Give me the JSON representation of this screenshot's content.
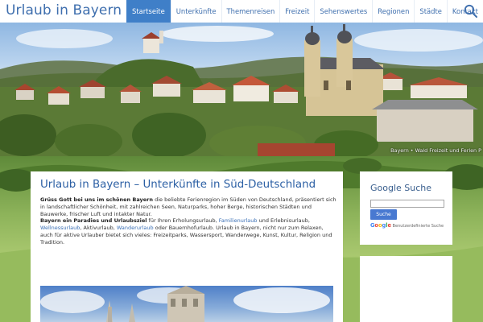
{
  "header": {
    "site_title": "Urlaub in Bayern",
    "nav": [
      {
        "label": "Startseite",
        "active": true
      },
      {
        "label": "Unterkünfte"
      },
      {
        "label": "Themenreisen"
      },
      {
        "label": "Freizeit"
      },
      {
        "label": "Sehenswertes"
      },
      {
        "label": "Regionen"
      },
      {
        "label": "Städte"
      },
      {
        "label": "Kontakt"
      }
    ],
    "search_icon": "search-icon"
  },
  "hero": {
    "caption": "Bayern • Wald Freizeit und Ferien P"
  },
  "main": {
    "title": "Urlaub in Bayern – Unterkünfte in Süd-Deutschland",
    "intro": {
      "p1_bold": "Grüss Gott bei uns im schönen Bayern",
      "p1_text": " die beliebte Ferienregion im Süden von Deutschland, präsentiert sich in landschaftlicher Schönheit, mit zahlreichen Seen, Naturparks, hoher Berge, historischen Städten und Bauwerke, frischer Luft und intakter Natur.",
      "p2_bold": "Bayern ein Paradies und Urlaubsziel",
      "p2_a": " für Ihren Erholungsurlaub, ",
      "link1": "Familienurlaub",
      "p2_b": " und Erlebnisurlaub, ",
      "link2": "Wellnessurlaub",
      "p2_c": ", Aktivurlaub, ",
      "link3": "Wanderurlaub",
      "p2_d": " oder Bauernhofurlaub. Urlaub in Bayern, nicht nur zum Relaxen, auch für aktive Urlauber bietet sich vieles: Freizeitparks, Wassersport, Wanderwege, Kunst, Kultur, Religion und Tradition."
    }
  },
  "sidebar": {
    "search_widget": {
      "title": "Google Suche",
      "input_value": "",
      "button_label": "Suche",
      "brand_word": "Google",
      "brand_text": " Benutzerdefinierte Suche"
    }
  },
  "colors": {
    "brand_blue": "#3f6fae",
    "nav_active": "#3f7fc8",
    "button_blue": "#4879d1"
  }
}
